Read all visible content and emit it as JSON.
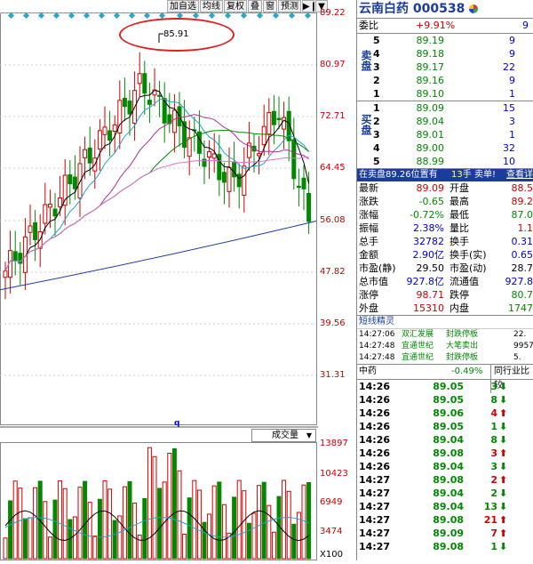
{
  "toolbar": {
    "buttons": [
      "加自选",
      "均线",
      "复权",
      "叠",
      "窗",
      "预测"
    ],
    "icons": [
      "arrow-to-end-icon",
      "chevron-down-icon"
    ]
  },
  "chart": {
    "price_axis": [
      "89.22",
      "80.97",
      "72.71",
      "64.45",
      "56.08",
      "47.82",
      "39.56",
      "31.31"
    ],
    "peak_label": "85.91",
    "volume_axis": [
      "13897",
      "10423",
      "6949",
      "3474"
    ],
    "volume_unit": "X100",
    "volume_selector": "成交量",
    "marker": "q",
    "annotation_color": "#e02020",
    "up_color": "#d00000",
    "down_color": "#008800",
    "ma_colors": [
      "#000000",
      "#1fa3c8",
      "#b0309a",
      "#008800",
      "#e070d0",
      "#1a3c9a"
    ]
  },
  "panel": {
    "stock_name": "云南白药",
    "stock_code": "000538",
    "r_mark": "R",
    "webi_label": "委比",
    "webi_value": "+9.91%",
    "webi_count": "9",
    "sell_label": "卖盘",
    "buy_label": "买盘",
    "asks": [
      {
        "level": "5",
        "price": "89.19",
        "vol": "9"
      },
      {
        "level": "4",
        "price": "89.18",
        "vol": "9"
      },
      {
        "level": "3",
        "price": "89.17",
        "vol": "22"
      },
      {
        "level": "2",
        "price": "89.16",
        "vol": "9"
      },
      {
        "level": "1",
        "price": "89.10",
        "vol": "1"
      }
    ],
    "bids": [
      {
        "level": "1",
        "price": "89.09",
        "vol": "15"
      },
      {
        "level": "2",
        "price": "89.04",
        "vol": "3"
      },
      {
        "level": "3",
        "price": "89.01",
        "vol": "1"
      },
      {
        "level": "4",
        "price": "89.00",
        "vol": "32"
      },
      {
        "level": "5",
        "price": "88.99",
        "vol": "10"
      }
    ],
    "alert": {
      "text": "在卖盘89.26位置有",
      "count": "13手",
      "tag": "卖单!",
      "link": "查看详"
    },
    "stats": [
      {
        "l1": "最新",
        "v1": "89.09",
        "c1": "red",
        "l2": "开盘",
        "v2": "88.5",
        "c2": "red"
      },
      {
        "l1": "涨跌",
        "v1": "-0.65",
        "c1": "grn",
        "l2": "最高",
        "v2": "89.2",
        "c2": "red"
      },
      {
        "l1": "涨幅",
        "v1": "-0.72%",
        "c1": "grn",
        "l2": "最低",
        "v2": "87.0",
        "c2": "grn"
      },
      {
        "l1": "振幅",
        "v1": "2.38%",
        "c1": "blue",
        "l2": "量比",
        "v2": "1.1",
        "c2": "red"
      },
      {
        "l1": "总手",
        "v1": "32782",
        "c1": "blue",
        "l2": "换手",
        "v2": "0.31",
        "c2": "blue"
      },
      {
        "l1": "金额",
        "v1": "2.90亿",
        "c1": "blue",
        "l2": "换手(实)",
        "v2": "0.65",
        "c2": "blue"
      },
      {
        "l1": "市盈(静)",
        "v1": "29.50",
        "c1": "",
        "l2": "市盈(动)",
        "v2": "28.7",
        "c2": ""
      },
      {
        "l1": "总市值",
        "v1": "927.8亿",
        "c1": "blue",
        "l2": "流通值",
        "v2": "927.8",
        "c2": "blue"
      },
      {
        "l1": "涨停",
        "v1": "98.71",
        "c1": "red",
        "l2": "跌停",
        "v2": "80.7",
        "c2": "grn"
      },
      {
        "l1": "外盘",
        "v1": "15310",
        "c1": "red",
        "l2": "内盘",
        "v2": "1747",
        "c2": "grn"
      }
    ],
    "sprite_title": "短线精灵",
    "sprites": [
      {
        "time": "14:27:06",
        "name": "双汇发展",
        "event": "封跌停板",
        "val": "22."
      },
      {
        "time": "14:27:48",
        "name": "宜通世纪",
        "event": "大笔卖出",
        "val": "9957"
      },
      {
        "time": "14:27:48",
        "name": "宜通世纪",
        "event": "封跌停板",
        "val": "5."
      }
    ],
    "industry": {
      "name": "中药",
      "change": "-0.49%",
      "rank_label": "同行业比较"
    },
    "ticks": [
      {
        "time": "14:26",
        "price": "89.05",
        "vol": "3",
        "dir": "down"
      },
      {
        "time": "14:26",
        "price": "89.05",
        "vol": "8",
        "dir": "down"
      },
      {
        "time": "14:26",
        "price": "89.06",
        "vol": "4",
        "dir": "up"
      },
      {
        "time": "14:26",
        "price": "89.05",
        "vol": "1",
        "dir": "down"
      },
      {
        "time": "14:26",
        "price": "89.04",
        "vol": "8",
        "dir": "down"
      },
      {
        "time": "14:26",
        "price": "89.08",
        "vol": "3",
        "dir": "up"
      },
      {
        "time": "14:26",
        "price": "89.04",
        "vol": "3",
        "dir": "down"
      },
      {
        "time": "14:27",
        "price": "89.08",
        "vol": "2",
        "dir": "up"
      },
      {
        "time": "14:27",
        "price": "89.04",
        "vol": "2",
        "dir": "down"
      },
      {
        "time": "14:27",
        "price": "89.04",
        "vol": "13",
        "dir": "down"
      },
      {
        "time": "14:27",
        "price": "89.08",
        "vol": "21",
        "dir": "up"
      },
      {
        "time": "14:27",
        "price": "89.09",
        "vol": "7",
        "dir": "up"
      },
      {
        "time": "14:27",
        "price": "89.08",
        "vol": "1",
        "dir": "down"
      }
    ]
  }
}
